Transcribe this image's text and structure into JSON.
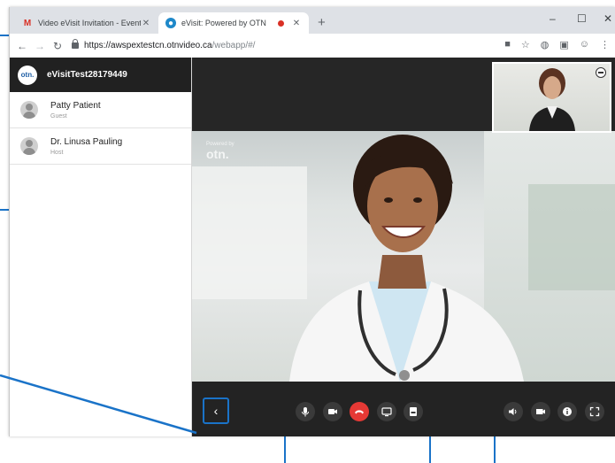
{
  "browser": {
    "tabs": [
      {
        "title": "Video eVisit Invitation - Event ID",
        "favicon": "gmail-icon",
        "active": false
      },
      {
        "title": "eVisit: Powered by OTN",
        "favicon": "otn-icon",
        "active": true,
        "recording": true
      }
    ],
    "url_host": "https://awspextestcn.otnvideo.ca",
    "url_path": "/webapp/#/"
  },
  "sidebar": {
    "logo_text": "otn.",
    "room_name": "eVisitTest28179449",
    "participants": [
      {
        "name": "Patty Patient",
        "role": "Guest"
      },
      {
        "name": "Dr. Linusa Pauling",
        "role": "Host"
      }
    ]
  },
  "video": {
    "watermark_small": "Powered by",
    "watermark_big": "otn."
  },
  "controls": {
    "collapse_label": "‹",
    "buttons": [
      "microphone-icon",
      "camera-icon",
      "hang-up-icon",
      "screen-share-icon",
      "pdf-icon",
      "volume-icon",
      "camera-switch-icon",
      "info-icon",
      "fullscreen-icon"
    ],
    "hangup_color": "#e53935"
  },
  "colors": {
    "callout": "#1a73c8",
    "sidebar_header": "#212121"
  }
}
